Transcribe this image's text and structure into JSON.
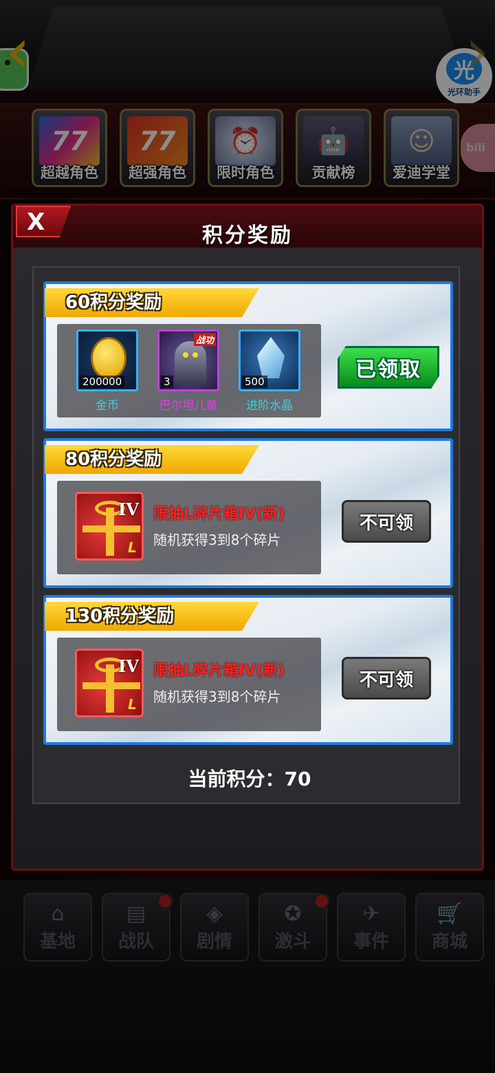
{
  "top_menu": {
    "tiles": [
      {
        "label": "超越角色"
      },
      {
        "label": "超强角色"
      },
      {
        "label": "限时角色"
      },
      {
        "label": "贡献榜"
      },
      {
        "label": "爱迪学堂"
      }
    ]
  },
  "assistant": {
    "glyph": "光",
    "label": "光环助手"
  },
  "bili": {
    "text": "bili"
  },
  "modal": {
    "close_label": "X",
    "title": "积分奖励",
    "rewards": [
      {
        "banner": "60积分奖励",
        "items": [
          {
            "name": "金币",
            "qty": "200000",
            "color": "#3ad0e0"
          },
          {
            "name": "巴尔坦儿童",
            "qty": "3",
            "color": "#e040e0",
            "tag": "战功"
          },
          {
            "name": "进阶水晶",
            "qty": "500",
            "color": "#3ad0e0"
          }
        ],
        "status": "已领取"
      },
      {
        "banner": "80积分奖励",
        "gift": {
          "roman": "IV",
          "l_mark": "L",
          "title": "限抽L碎片箱IV(新)",
          "desc": "随机获得3到8个碎片"
        },
        "status": "不可领"
      },
      {
        "banner": "130积分奖励",
        "gift": {
          "roman": "IV",
          "l_mark": "L",
          "title": "限抽L碎片箱IV(新)",
          "desc": "随机获得3到8个碎片"
        },
        "status": "不可领"
      }
    ],
    "score_label": "当前积分：",
    "score_value": "70"
  },
  "bottom_nav": [
    {
      "label": "基地"
    },
    {
      "label": "战队"
    },
    {
      "label": "剧情"
    },
    {
      "label": "激斗"
    },
    {
      "label": "事件"
    },
    {
      "label": "商城"
    }
  ],
  "colors": {
    "accent_blue": "#1e7ae0",
    "banner_gold": "#f0a800",
    "claimed_green": "#0a8a1a",
    "alert_red": "#ff2020"
  }
}
